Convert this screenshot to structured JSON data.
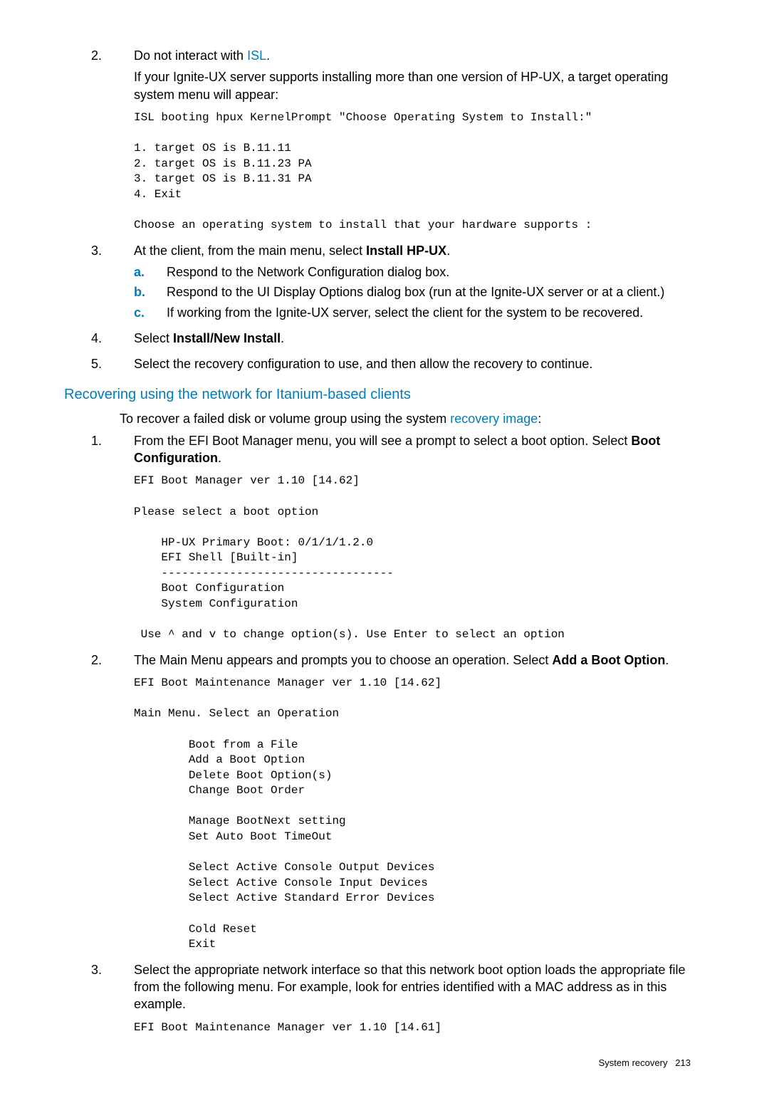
{
  "list1": {
    "item2_num": "2.",
    "item2_text_pre": "Do not interact with ",
    "item2_text_link": "ISL",
    "item2_text_post": ".",
    "item2_para": "If your Ignite-UX server supports installing more than one version of HP-UX, a target operating system menu will appear:",
    "code1": "ISL booting hpux KernelPrompt \"Choose Operating System to Install:\"\n\n1. target OS is B.11.11\n2. target OS is B.11.23 PA\n3. target OS is B.11.31 PA\n4. Exit\n\nChoose an operating system to install that your hardware supports :",
    "item3_num": "3.",
    "item3_text_pre": "At the client, from the main menu, select ",
    "item3_text_bold": "Install HP-UX",
    "item3_text_post": ".",
    "sub": {
      "a_letter": "a.",
      "a_text": "Respond to the Network Configuration dialog box.",
      "b_letter": "b.",
      "b_text": "Respond to the UI Display Options dialog box (run at the Ignite-UX server or at a client.)",
      "c_letter": "c.",
      "c_text": "If working from the Ignite-UX server, select the client for the system to be recovered."
    },
    "item4_num": "4.",
    "item4_text_pre": "Select ",
    "item4_text_bold": "Install/New Install",
    "item4_text_post": ".",
    "item5_num": "5.",
    "item5_text": "Select the recovery configuration to use, and then allow the recovery to continue."
  },
  "section_heading": "Recovering using the network for Itanium-based clients",
  "intro_pre": "To recover a failed disk or volume group using the system ",
  "intro_link": "recovery image",
  "intro_post": ":",
  "list2": {
    "item1_num": "1.",
    "item1_text_pre": "From the EFI Boot Manager menu, you will see a prompt to select a boot option. Select ",
    "item1_text_bold": "Boot Configuration",
    "item1_text_post": ".",
    "code1": "EFI Boot Manager ver 1.10 [14.62]\n\nPlease select a boot option\n\n    HP-UX Primary Boot: 0/1/1/1.2.0\n    EFI Shell [Built-in]\n    ----------------------------------\n    Boot Configuration\n    System Configuration\n\n Use ^ and v to change option(s). Use Enter to select an option",
    "item2_num": "2.",
    "item2_text_pre": "The Main Menu appears and prompts you to choose an operation. Select ",
    "item2_text_bold": "Add a Boot Option",
    "item2_text_post": ".",
    "code2": "EFI Boot Maintenance Manager ver 1.10 [14.62]\n\nMain Menu. Select an Operation\n\n        Boot from a File\n        Add a Boot Option\n        Delete Boot Option(s)\n        Change Boot Order\n\n        Manage BootNext setting\n        Set Auto Boot TimeOut\n\n        Select Active Console Output Devices\n        Select Active Console Input Devices\n        Select Active Standard Error Devices\n\n        Cold Reset\n        Exit",
    "item3_num": "3.",
    "item3_text": "Select the appropriate network interface so that this network boot option loads the appropriate file from the following menu. For example, look for entries identified with a MAC address as in this example.",
    "code3": "EFI Boot Maintenance Manager ver 1.10 [14.61]"
  },
  "footer_text": "System recovery",
  "footer_page": "213"
}
